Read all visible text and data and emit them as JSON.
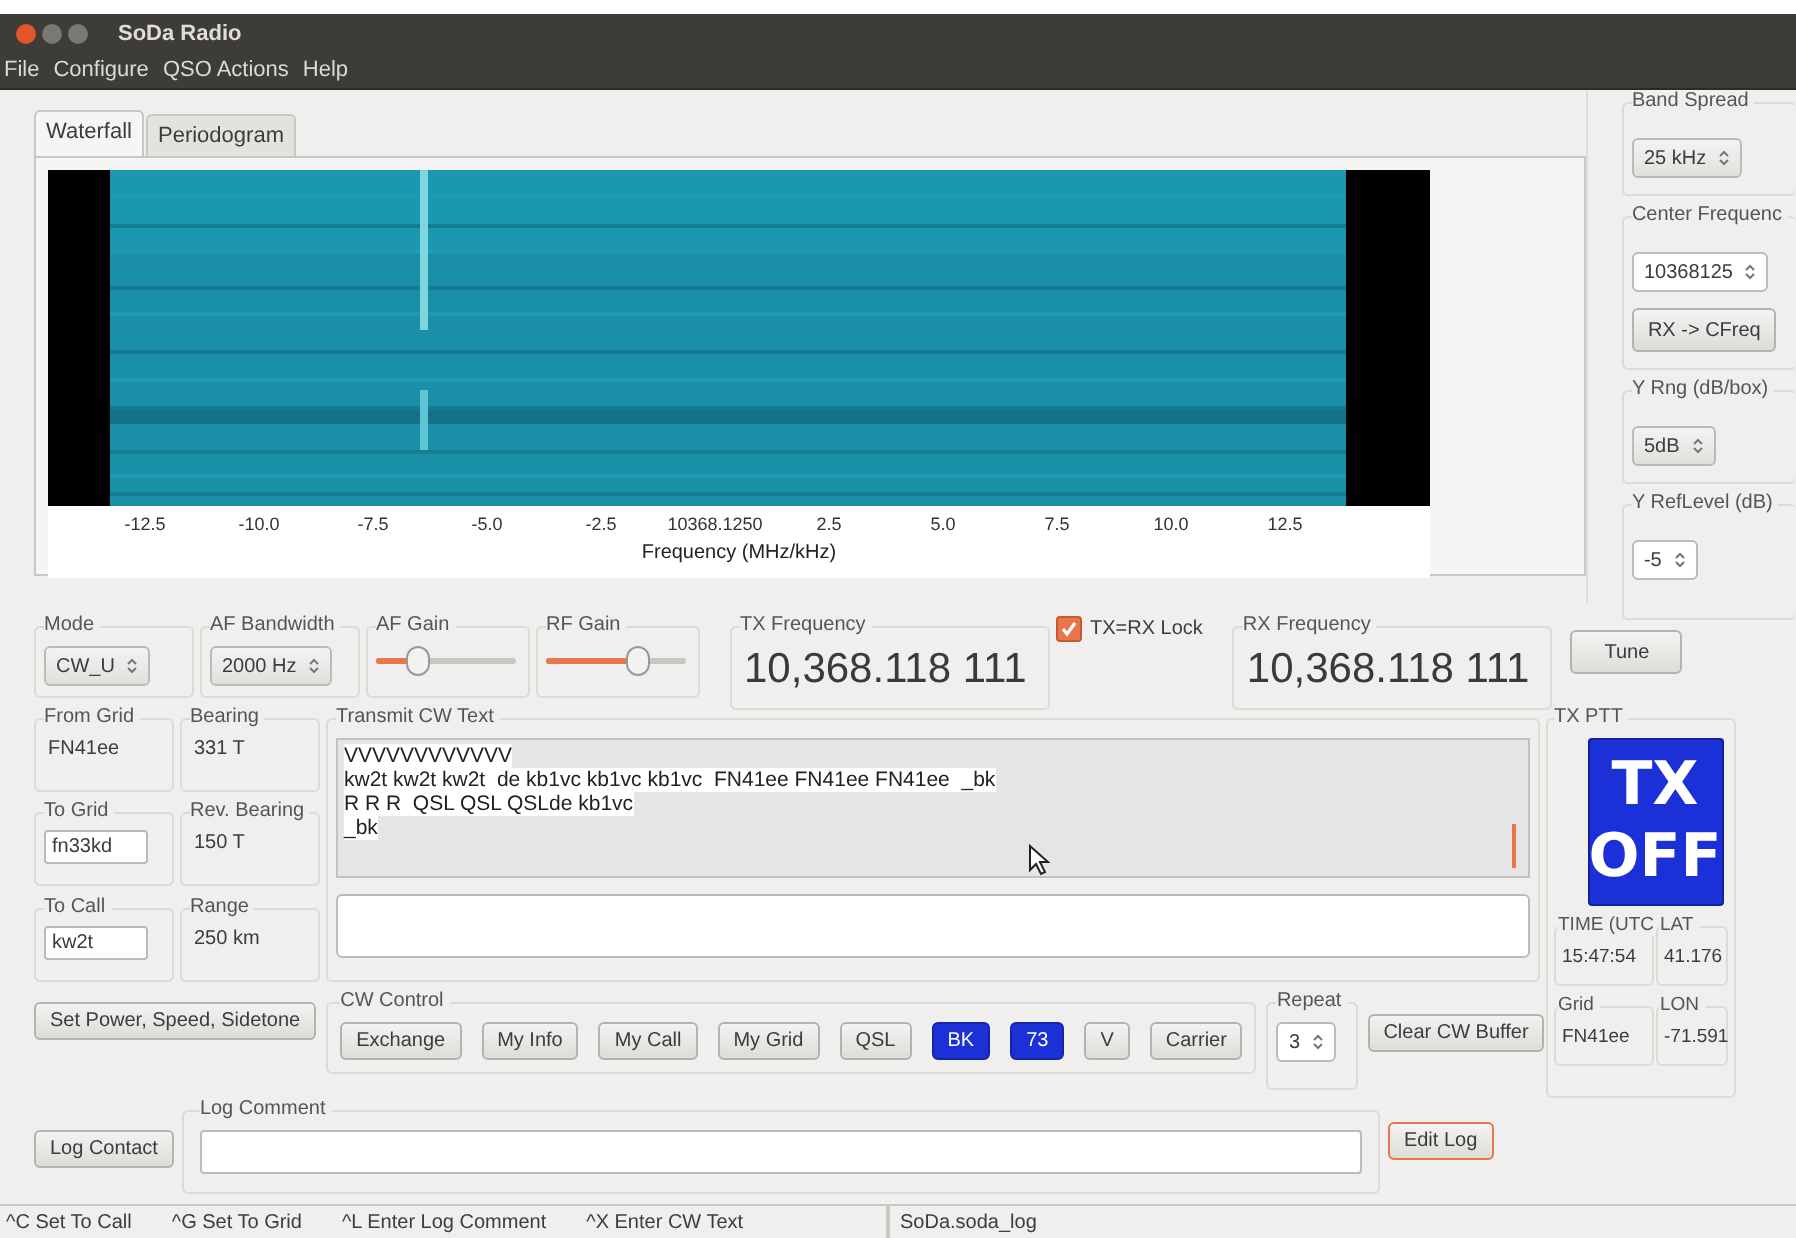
{
  "window": {
    "title": "SoDa Radio"
  },
  "menu": [
    "File",
    "Configure",
    "QSO Actions",
    "Help"
  ],
  "tabs": [
    {
      "label": "Waterfall",
      "selected": true
    },
    {
      "label": "Periodogram",
      "selected": false
    }
  ],
  "waterfall": {
    "x_ticks": [
      "-12.5",
      "-10.0",
      "-7.5",
      "-5.0",
      "-2.5",
      "10368.1250",
      "2.5",
      "5.0",
      "7.5",
      "10.0",
      "12.5"
    ],
    "xlabel": "Frequency (MHz/kHz)"
  },
  "side_panel": [
    {
      "label": "Band Spread",
      "controls": [
        {
          "kind": "combo",
          "value": "25 kHz"
        }
      ]
    },
    {
      "label": "Center Frequenc",
      "controls": [
        {
          "kind": "spin",
          "value": "10368125"
        },
        {
          "kind": "button",
          "value": "RX -> CFreq"
        }
      ]
    },
    {
      "label": "Y Rng (dB/box)",
      "controls": [
        {
          "kind": "combo",
          "value": "5dB"
        }
      ]
    },
    {
      "label": "Y RefLevel (dB)",
      "controls": [
        {
          "kind": "spin",
          "value": "-5"
        }
      ]
    }
  ],
  "mode": {
    "label": "Mode",
    "value": "CW_U"
  },
  "af_bandwidth": {
    "label": "AF Bandwidth",
    "value": "2000 Hz"
  },
  "gains": [
    {
      "label": "AF Gain",
      "level": 0.3
    },
    {
      "label": "RF Gain",
      "level": 0.65
    }
  ],
  "tx_frequency": {
    "label": "TX Frequency",
    "value": "10,368.118 111"
  },
  "tx_rx_lock": {
    "label": "TX=RX Lock",
    "checked": true
  },
  "rx_frequency": {
    "label": "RX Frequency",
    "value": "10,368.118 111"
  },
  "tune_button": "Tune",
  "qso_info": [
    {
      "label": "From Grid",
      "value": "FN41ee",
      "kind": "text"
    },
    {
      "label": "Bearing",
      "value": "331 T",
      "kind": "text"
    },
    {
      "label": "To Grid",
      "value": "fn33kd",
      "kind": "field"
    },
    {
      "label": "Rev. Bearing",
      "value": "150 T",
      "kind": "text"
    },
    {
      "label": "To Call",
      "value": "kw2t",
      "kind": "field"
    },
    {
      "label": "Range",
      "value": "250 km",
      "kind": "text"
    }
  ],
  "transmit_cw_text": {
    "label": "Transmit CW Text",
    "lines": [
      "VVVVVVVVVVVV",
      "kw2t kw2t kw2t  de kb1vc kb1vc kb1vc  FN41ee FN41ee FN41ee  _bk",
      "R R R  QSL QSL QSLde kb1vc",
      "_bk"
    ]
  },
  "tx_ptt": {
    "label": "TX PTT",
    "button": [
      "TX",
      "OFF"
    ],
    "fields": [
      {
        "label": "TIME (UTC",
        "value": "15:47:54"
      },
      {
        "label": "LAT",
        "value": "41.176"
      },
      {
        "label": "Grid",
        "value": "FN41ee"
      },
      {
        "label": "LON",
        "value": "-71.591"
      }
    ]
  },
  "set_power_button": "Set Power, Speed, Sidetone",
  "cw_control": {
    "label": "CW Control",
    "buttons": [
      {
        "label": "Exchange",
        "highlighted": false
      },
      {
        "label": "My Info",
        "highlighted": false
      },
      {
        "label": "My Call",
        "highlighted": false
      },
      {
        "label": "My Grid",
        "highlighted": false
      },
      {
        "label": "QSL",
        "highlighted": false
      },
      {
        "label": "BK",
        "highlighted": true
      },
      {
        "label": "73",
        "highlighted": true
      },
      {
        "label": "V",
        "highlighted": false
      },
      {
        "label": "Carrier",
        "highlighted": false
      }
    ]
  },
  "repeat": {
    "label": "Repeat",
    "value": "3"
  },
  "clear_cw_buffer_button": "Clear CW Buffer",
  "log_contact_button": "Log Contact",
  "log_comment": {
    "label": "Log Comment"
  },
  "edit_log_button": {
    "label": "Edit Log",
    "focused": true
  },
  "status_bar": {
    "hints": [
      "^C Set To Call",
      "^G Set To Grid",
      "^L Enter Log Comment",
      "^X Enter CW Text"
    ],
    "log_file": "SoDa.soda_log"
  }
}
